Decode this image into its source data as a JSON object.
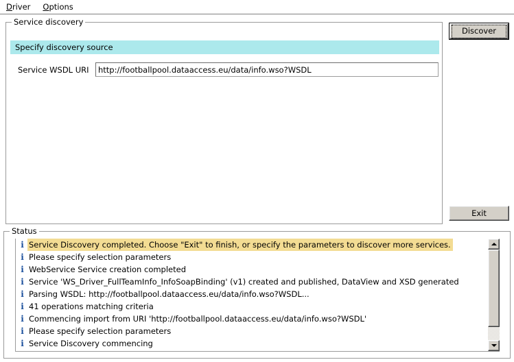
{
  "menubar": {
    "items": [
      {
        "accel": "D",
        "rest": "river",
        "name": "menu-driver"
      },
      {
        "accel": "O",
        "rest": "ptions",
        "name": "menu-options"
      }
    ]
  },
  "service_discovery": {
    "group_title": "Service discovery",
    "section_header": "Specify discovery source",
    "uri_label": "Service WSDL URI",
    "uri_value": "http://footballpool.dataaccess.eu/data/info.wso?WSDL",
    "uri_placeholder": ""
  },
  "buttons": {
    "discover": "Discover",
    "exit": "Exit"
  },
  "status": {
    "group_title": "Status",
    "info_icon_glyph": "i",
    "info_icon_color": "#1a4f9c",
    "highlight_color": "#f3dc93",
    "rows": [
      {
        "icon": "info-icon",
        "text": "Service Discovery completed. Choose \"Exit\" to finish, or specify the parameters to discover more services.",
        "highlighted": true
      },
      {
        "icon": "info-icon",
        "text": "Please specify selection parameters",
        "highlighted": false
      },
      {
        "icon": "info-icon",
        "text": "WebService Service creation completed",
        "highlighted": false
      },
      {
        "icon": "info-icon",
        "text": "Service 'WS_Driver_FullTeamInfo_InfoSoapBinding' (v1) created and published, DataView and XSD generated",
        "highlighted": false
      },
      {
        "icon": "info-icon",
        "text": "Parsing WSDL: http://footballpool.dataaccess.eu/data/info.wso?WSDL...",
        "highlighted": false
      },
      {
        "icon": "info-icon",
        "text": "41 operations matching criteria",
        "highlighted": false
      },
      {
        "icon": "info-icon",
        "text": "Commencing import from URI 'http://footballpool.dataaccess.eu/data/info.wso?WSDL'",
        "highlighted": false
      },
      {
        "icon": "info-icon",
        "text": "Please specify selection parameters",
        "highlighted": false
      },
      {
        "icon": "info-icon",
        "text": "Service Discovery commencing",
        "highlighted": false
      }
    ]
  },
  "colors": {
    "section_header_bg": "#ace9ec",
    "button_face": "#d4d0c8",
    "groupbox_border": "#9a9a9a"
  }
}
